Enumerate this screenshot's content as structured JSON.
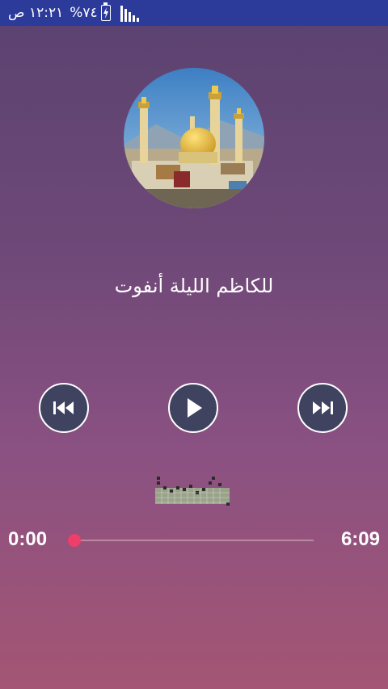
{
  "status_bar": {
    "time": "١٢:٢١ ص",
    "battery": "%٧٤"
  },
  "track": {
    "title": "للكاظم الليلة أنفوت"
  },
  "controls": {
    "previous_icon": "skip-previous-icon",
    "play_icon": "play-icon",
    "next_icon": "skip-next-icon"
  },
  "progress": {
    "current_time": "0:00",
    "total_time": "6:09",
    "position_fraction": 0.0
  },
  "colors": {
    "status_bar": "#2c3a9a",
    "accent": "#ee3e6b",
    "button_fill": "#3f4360"
  }
}
